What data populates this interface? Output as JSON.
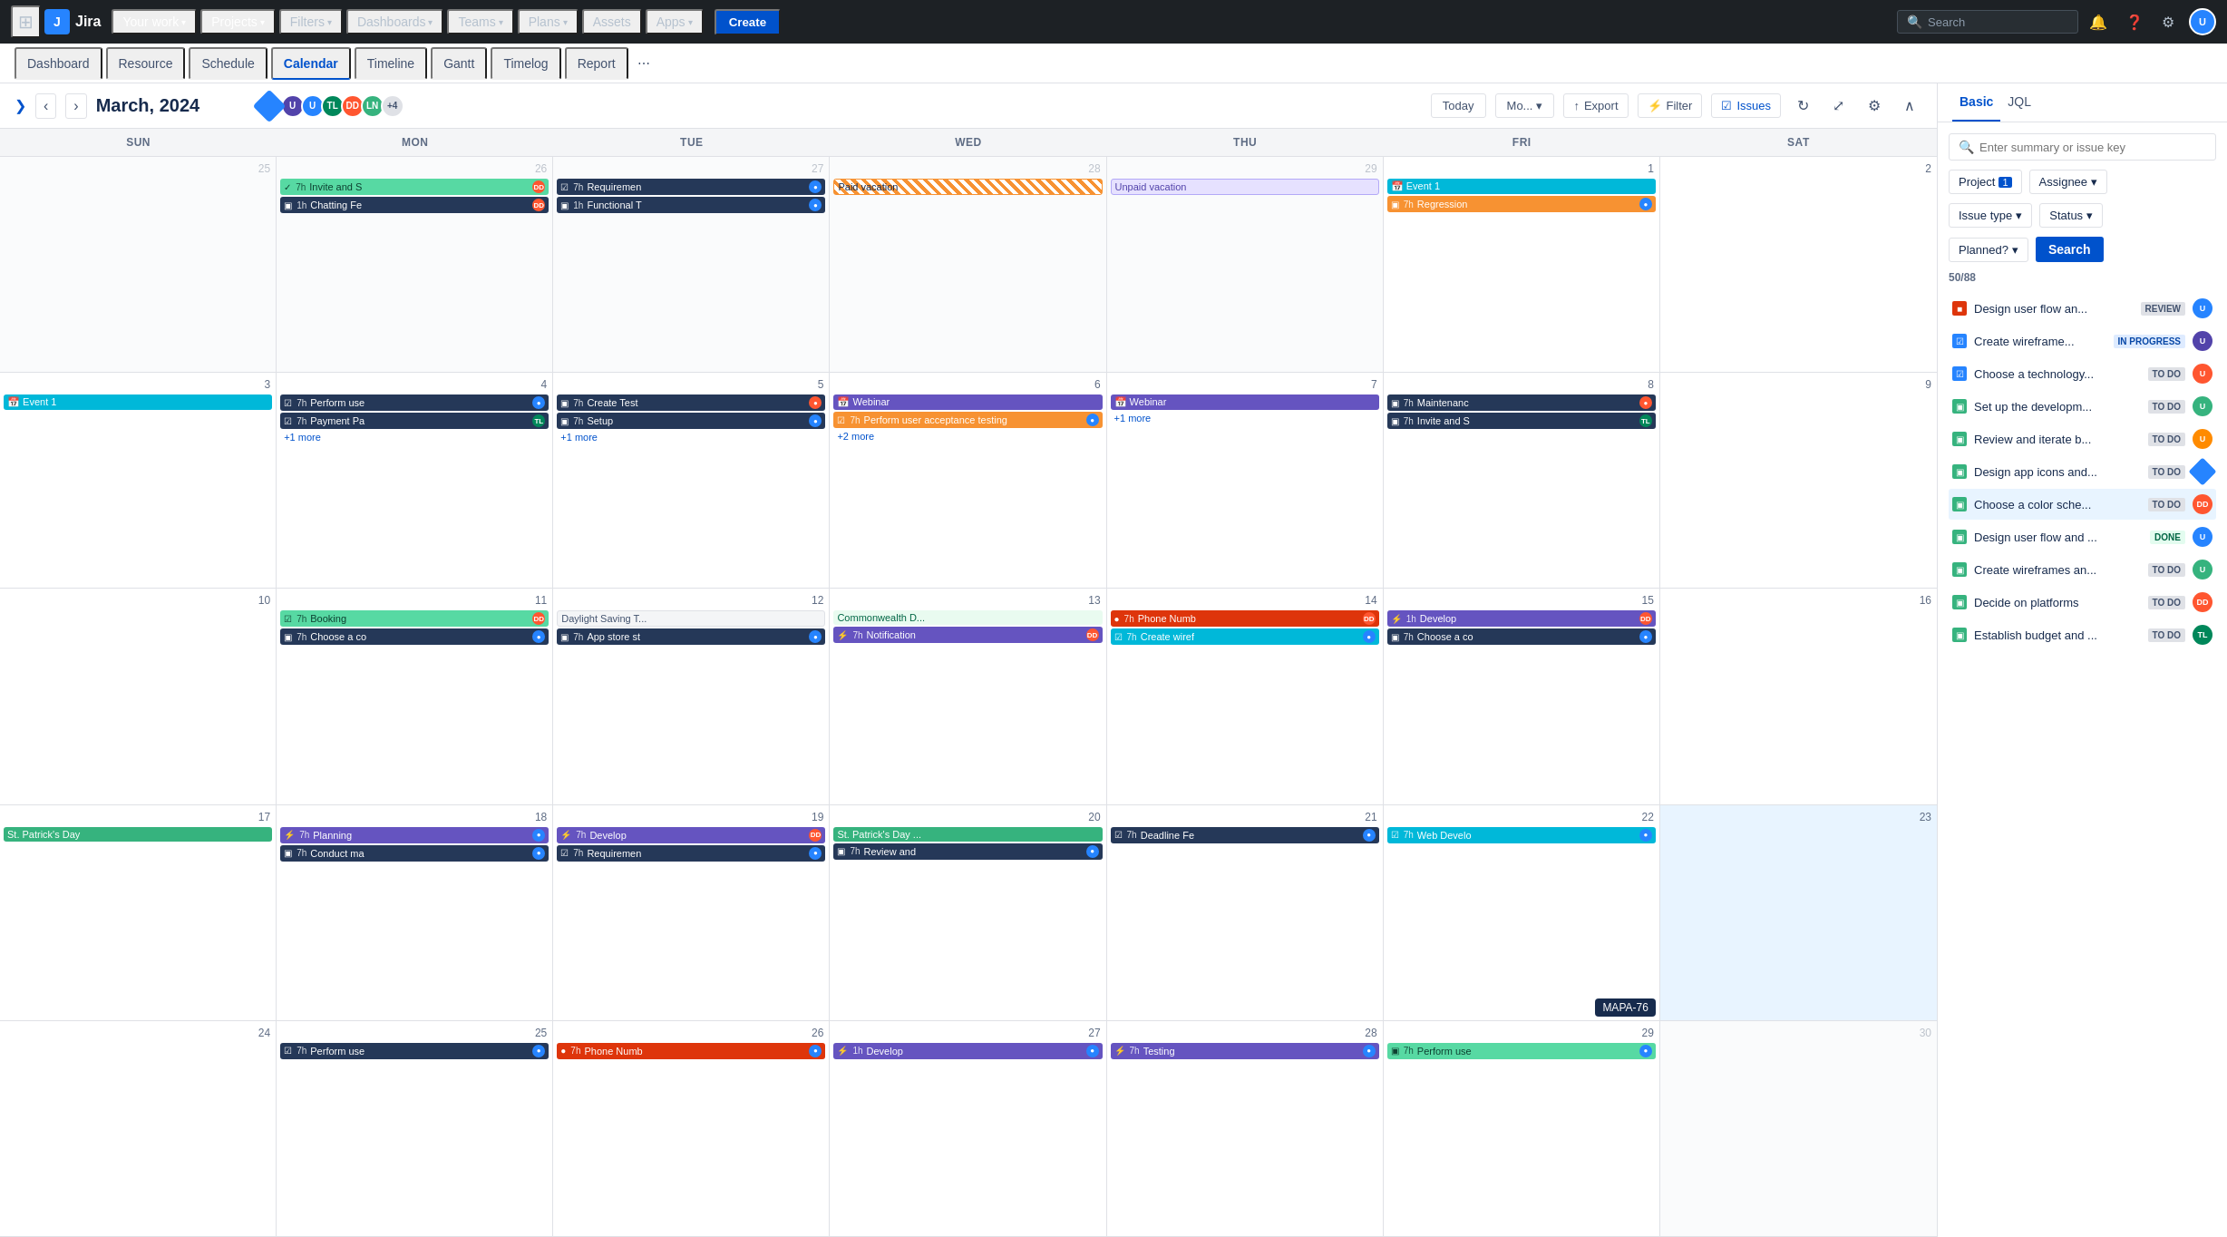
{
  "app": {
    "name": "Jira",
    "logo_text": "Jira"
  },
  "topnav": {
    "apps_icon": "⊞",
    "items": [
      {
        "label": "Your work",
        "has_chevron": true,
        "active": false
      },
      {
        "label": "Projects",
        "has_chevron": true,
        "active": true
      },
      {
        "label": "Filters",
        "has_chevron": true,
        "active": false
      },
      {
        "label": "Dashboards",
        "has_chevron": true,
        "active": false
      },
      {
        "label": "Teams",
        "has_chevron": true,
        "active": false
      },
      {
        "label": "Plans",
        "has_chevron": true,
        "active": false
      },
      {
        "label": "Assets",
        "has_chevron": false,
        "active": false
      },
      {
        "label": "Apps",
        "has_chevron": true,
        "active": false
      }
    ],
    "create_label": "Create",
    "search_placeholder": "Search",
    "notification_icon": "🔔",
    "help_icon": "?",
    "settings_icon": "⚙",
    "avatar_label": "U"
  },
  "subnav": {
    "items": [
      {
        "label": "Dashboard",
        "active": false
      },
      {
        "label": "Resource",
        "active": false
      },
      {
        "label": "Schedule",
        "active": false
      },
      {
        "label": "Calendar",
        "active": true
      },
      {
        "label": "Timeline",
        "active": false
      },
      {
        "label": "Gantt",
        "active": false
      },
      {
        "label": "Timelog",
        "active": false
      },
      {
        "label": "Report",
        "active": false
      }
    ],
    "more_icon": "⋯"
  },
  "calendar": {
    "prev_icon": "‹",
    "next_icon": "›",
    "title": "March, 2024",
    "avatars": [
      {
        "color": "#2684ff",
        "label": "◇",
        "type": "diamond"
      },
      {
        "color": "#5243aa",
        "label": "U1"
      },
      {
        "color": "#2684ff",
        "label": "U2"
      },
      {
        "color": "#00875a",
        "label": "TL"
      },
      {
        "color": "#ff5630",
        "label": "DD"
      },
      {
        "color": "#36b37e",
        "label": "LN"
      },
      {
        "color": "#dfe1e6",
        "label": "+4",
        "type": "more"
      }
    ],
    "today_label": "Today",
    "mode_label": "Mo...",
    "export_label": "Export",
    "filter_label": "Filter",
    "issues_label": "Issues",
    "day_names": [
      "SUN",
      "MON",
      "TUE",
      "WED",
      "THU",
      "FRI",
      "SAT"
    ],
    "weeks": [
      {
        "days": [
          {
            "date": "25",
            "other": true,
            "events": []
          },
          {
            "date": "26",
            "other": true,
            "events": [
              {
                "type": "green",
                "time": "7h",
                "text": "Invite and S",
                "avatar": "DD",
                "av_color": "#ff5630"
              },
              {
                "type": "dark",
                "time": "1h",
                "text": "Chatting Fe",
                "avatar": "DD",
                "av_color": "#ff5630"
              }
            ]
          },
          {
            "date": "27",
            "other": true,
            "events": [
              {
                "type": "dark",
                "time": "7h",
                "text": "Requiremen",
                "avatar": "🔵",
                "av_color": "#2684ff"
              },
              {
                "type": "dark",
                "time": "1h",
                "text": "Functional T",
                "avatar": "🔵",
                "av_color": "#2684ff"
              }
            ]
          },
          {
            "date": "28",
            "other": true,
            "events": [
              {
                "type": "paid",
                "text": "Paid vacation",
                "full": true
              }
            ]
          },
          {
            "date": "29",
            "other": true,
            "events": [
              {
                "type": "unpaid",
                "text": "Unpaid vacation",
                "full": true
              }
            ]
          },
          {
            "date": "1",
            "events": [
              {
                "type": "event1",
                "text": "Event 1",
                "full": true,
                "icon": "📅"
              },
              {
                "type": "orange",
                "time": "7h",
                "text": "Regression",
                "avatar": "🔵",
                "av_color": "#2684ff"
              }
            ]
          },
          {
            "date": "2",
            "events": []
          }
        ]
      },
      {
        "days": [
          {
            "date": "3",
            "events": [
              {
                "type": "event1",
                "text": "Event 1",
                "full": true,
                "icon": "📅"
              }
            ]
          },
          {
            "date": "4",
            "events": [
              {
                "type": "dark",
                "time": "7h",
                "text": "Perform use",
                "avatar": "🔵",
                "av_color": "#2684ff"
              },
              {
                "type": "dark",
                "time": "7h",
                "text": "Payment Pa",
                "avatar": "TL",
                "av_color": "#00875a"
              },
              {
                "more": "+1 more"
              }
            ]
          },
          {
            "date": "5",
            "events": [
              {
                "type": "dark",
                "time": "7h",
                "text": "Create Test",
                "avatar": "🔵",
                "av_color": "#ff5630"
              },
              {
                "type": "dark",
                "time": "7h",
                "text": "Setup",
                "avatar": "🔵",
                "av_color": "#2684ff"
              },
              {
                "more": "+1 more"
              }
            ]
          },
          {
            "date": "6",
            "events": [
              {
                "type": "webinar",
                "text": "Webinar",
                "full": true,
                "icon": "📅"
              },
              {
                "type": "orange",
                "time": "7h",
                "text": "Perform user acceptance testing",
                "avatar": "🔵",
                "av_color": "#2684ff"
              },
              {
                "more": "+2 more"
              }
            ]
          },
          {
            "date": "7",
            "events": [
              {
                "type": "webinar",
                "text": "Webinar",
                "full": true,
                "icon": "📅"
              },
              {
                "more": "+1 more"
              }
            ]
          },
          {
            "date": "8",
            "events": [
              {
                "type": "dark",
                "time": "7h",
                "text": "Maintenanc",
                "avatar": "🔵",
                "av_color": "#ff5630"
              },
              {
                "type": "dark",
                "time": "7h",
                "text": "Invite and S",
                "avatar": "TL",
                "av_color": "#00875a"
              }
            ]
          },
          {
            "date": "9",
            "events": []
          }
        ]
      },
      {
        "days": [
          {
            "date": "10",
            "events": []
          },
          {
            "date": "11",
            "events": [
              {
                "type": "green",
                "time": "7h",
                "text": "Booking",
                "avatar": "DD",
                "av_color": "#ff5630"
              },
              {
                "type": "dark",
                "time": "7h",
                "text": "Choose a co",
                "avatar": "🔵",
                "av_color": "#2684ff"
              }
            ]
          },
          {
            "date": "12",
            "events": [
              {
                "type": "daylight",
                "text": "Daylight Saving T...",
                "full": true
              },
              {
                "type": "dark",
                "time": "7h",
                "text": "App store st",
                "avatar": "🔵",
                "av_color": "#2684ff"
              }
            ]
          },
          {
            "date": "13",
            "events": [
              {
                "type": "commonwealth",
                "text": "Commonwealth D...",
                "full": true
              },
              {
                "type": "purple",
                "time": "7h",
                "text": "Notification",
                "avatar": "DD",
                "av_color": "#ff5630"
              }
            ]
          },
          {
            "date": "14",
            "events": [
              {
                "type": "red",
                "time": "7h",
                "text": "Phone Numb",
                "avatar": "DD",
                "av_color": "#ff5630"
              },
              {
                "type": "teal",
                "time": "7h",
                "text": "Create wiref",
                "avatar": "🔵",
                "av_color": "#2684ff"
              }
            ]
          },
          {
            "date": "15",
            "events": [
              {
                "type": "purple",
                "time": "1h",
                "text": "Develop",
                "avatar": "DD",
                "av_color": "#ff5630"
              },
              {
                "type": "dark",
                "time": "7h",
                "text": "Choose a co",
                "avatar": "🔵",
                "av_color": "#2684ff"
              }
            ]
          },
          {
            "date": "16",
            "events": []
          }
        ]
      },
      {
        "days": [
          {
            "date": "17",
            "events": [
              {
                "type": "stpatrick",
                "text": "St. Patrick's Day",
                "full": true
              }
            ]
          },
          {
            "date": "18",
            "events": [
              {
                "type": "purple",
                "time": "7h",
                "text": "Planning",
                "avatar": "🔵",
                "av_color": "#2684ff"
              },
              {
                "type": "dark",
                "time": "7h",
                "text": "Conduct ma",
                "avatar": "🔵",
                "av_color": "#2684ff"
              }
            ]
          },
          {
            "date": "19",
            "events": [
              {
                "type": "purple",
                "time": "7h",
                "text": "Develop",
                "avatar": "DD",
                "av_color": "#ff5630"
              },
              {
                "type": "dark",
                "time": "7h",
                "text": "Requiremen",
                "avatar": "🔵",
                "av_color": "#2684ff"
              }
            ]
          },
          {
            "date": "20",
            "events": [
              {
                "type": "stpatrick",
                "text": "St. Patrick's Day ...",
                "full": true
              },
              {
                "type": "dark",
                "time": "7h",
                "text": "Review and",
                "avatar": "🔵",
                "av_color": "#2684ff"
              }
            ]
          },
          {
            "date": "21",
            "events": [
              {
                "type": "dark",
                "time": "7h",
                "text": "Deadline Fe",
                "avatar": "🔵",
                "av_color": "#2684ff"
              }
            ]
          },
          {
            "date": "22",
            "events": [
              {
                "type": "teal",
                "time": "7h",
                "text": "Web Develo",
                "avatar": "🔵",
                "av_color": "#2684ff"
              },
              {
                "tooltip": "MAPA-76"
              }
            ]
          },
          {
            "date": "23",
            "selected": true,
            "events": []
          }
        ]
      },
      {
        "days": [
          {
            "date": "24",
            "events": []
          },
          {
            "date": "25",
            "events": [
              {
                "type": "dark",
                "time": "7h",
                "text": "Perform use",
                "avatar": "🔵",
                "av_color": "#2684ff"
              }
            ]
          },
          {
            "date": "26",
            "events": [
              {
                "type": "red",
                "time": "7h",
                "text": "Phone Numb",
                "avatar": "🔵",
                "av_color": "#2684ff"
              }
            ]
          },
          {
            "date": "27",
            "events": [
              {
                "type": "purple",
                "time": "1h",
                "text": "Develop",
                "avatar": "🔵",
                "av_color": "#2684ff"
              }
            ]
          },
          {
            "date": "28",
            "events": [
              {
                "type": "purple",
                "time": "7h",
                "text": "Testing",
                "avatar": "🔵",
                "av_color": "#2684ff"
              }
            ]
          },
          {
            "date": "29",
            "events": [
              {
                "type": "green",
                "time": "7h",
                "text": "Perform use",
                "avatar": "🔵",
                "av_color": "#2684ff"
              }
            ]
          },
          {
            "date": "30",
            "other": true,
            "events": []
          }
        ]
      }
    ]
  },
  "right_panel": {
    "tabs": [
      {
        "label": "Basic",
        "active": true
      },
      {
        "label": "JQL",
        "active": false
      }
    ],
    "search_placeholder": "Enter summary or issue key",
    "project_label": "Project",
    "project_count": "1",
    "assignee_label": "Assignee",
    "issue_type_label": "Issue type",
    "status_label": "Status",
    "planned_label": "Planned?",
    "search_btn": "Search",
    "count_text": "50/88",
    "issues": [
      {
        "icon": "bug",
        "text": "Design user flow an...",
        "status": "REVIEW",
        "status_type": "review",
        "avatar": "U1",
        "av_color": "#2684ff"
      },
      {
        "icon": "task",
        "text": "Create wireframe...",
        "status": "IN PROGRESS",
        "status_type": "inprogress",
        "avatar": "U2",
        "av_color": "#5243aa"
      },
      {
        "icon": "task",
        "text": "Choose a technology...",
        "status": "TO DO",
        "status_type": "todo",
        "avatar": "U3",
        "av_color": "#ff5630"
      },
      {
        "icon": "story",
        "text": "Set up the developm...",
        "status": "TO DO",
        "status_type": "todo",
        "avatar": "U4",
        "av_color": "#36b37e"
      },
      {
        "icon": "story",
        "text": "Review and iterate b...",
        "status": "TO DO",
        "status_type": "todo",
        "avatar": "U5",
        "av_color": "#ff8b00"
      },
      {
        "icon": "story",
        "text": "Design app icons and...",
        "status": "TO DO",
        "status_type": "todo",
        "avatar": "◇",
        "av_color": "#2684ff",
        "diamond": true
      },
      {
        "icon": "story",
        "text": "Choose a color sche...",
        "status": "TO DO",
        "status_type": "todo",
        "avatar": "DD",
        "av_color": "#ff5630",
        "highlighted": true
      },
      {
        "icon": "story",
        "text": "Design user flow and ...",
        "status": "DONE",
        "status_type": "done",
        "avatar": "U6",
        "av_color": "#2684ff"
      },
      {
        "icon": "story",
        "text": "Create wireframes an...",
        "status": "TO DO",
        "status_type": "todo",
        "avatar": "U7",
        "av_color": "#36b37e"
      },
      {
        "icon": "story",
        "text": "Decide on platforms",
        "status": "TO DO",
        "status_type": "todo",
        "avatar": "DD",
        "av_color": "#ff5630"
      },
      {
        "icon": "story",
        "text": "Establish budget and ...",
        "status": "TO DO",
        "status_type": "todo",
        "avatar": "TL",
        "av_color": "#00875a"
      }
    ]
  }
}
